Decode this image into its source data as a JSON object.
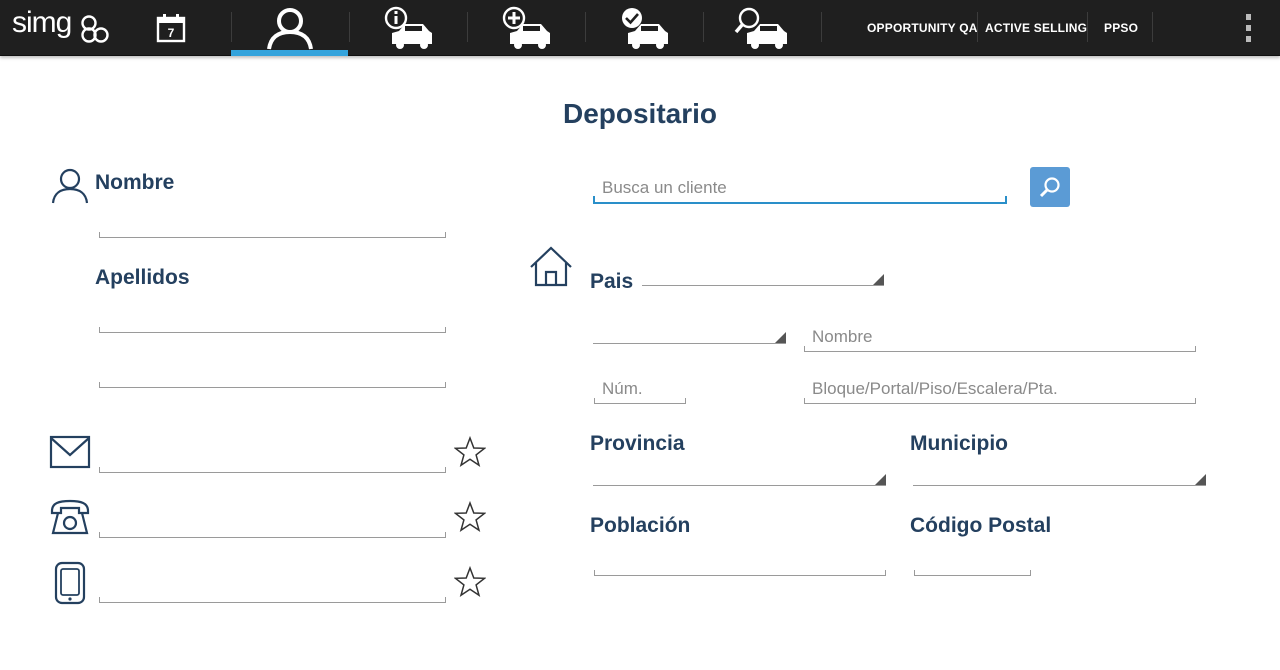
{
  "app": {
    "logo_text": "simg",
    "nav": {
      "calendar_day": "7",
      "menu_items": [
        "OPPORTUNITY QA",
        "ACTIVE SELLING",
        "PPSO"
      ]
    }
  },
  "page": {
    "title": "Depositario"
  },
  "customer": {
    "nombre_label": "Nombre",
    "apellidos_label": "Apellidos",
    "search_placeholder": "Busca un cliente"
  },
  "address": {
    "pais_label": "Pais",
    "street_name_placeholder": "Nombre",
    "number_placeholder": "Núm.",
    "detail_placeholder": "Bloque/Portal/Piso/Escalera/Pta.",
    "provincia_label": "Provincia",
    "municipio_label": "Municipio",
    "poblacion_label": "Población",
    "codigo_postal_label": "Código Postal"
  },
  "colors": {
    "topbar": "#1f1f1f",
    "accent": "#33a3dc",
    "heading": "#24405f",
    "search_button": "#5b9bd5"
  },
  "icons": {
    "nav": [
      "calendar-icon",
      "person-icon",
      "car-info-icon",
      "car-add-icon",
      "car-check-icon",
      "car-search-icon"
    ],
    "contact": [
      "email-icon",
      "phone-icon",
      "mobile-icon"
    ],
    "favorite": "star-icon",
    "address": "house-icon"
  }
}
